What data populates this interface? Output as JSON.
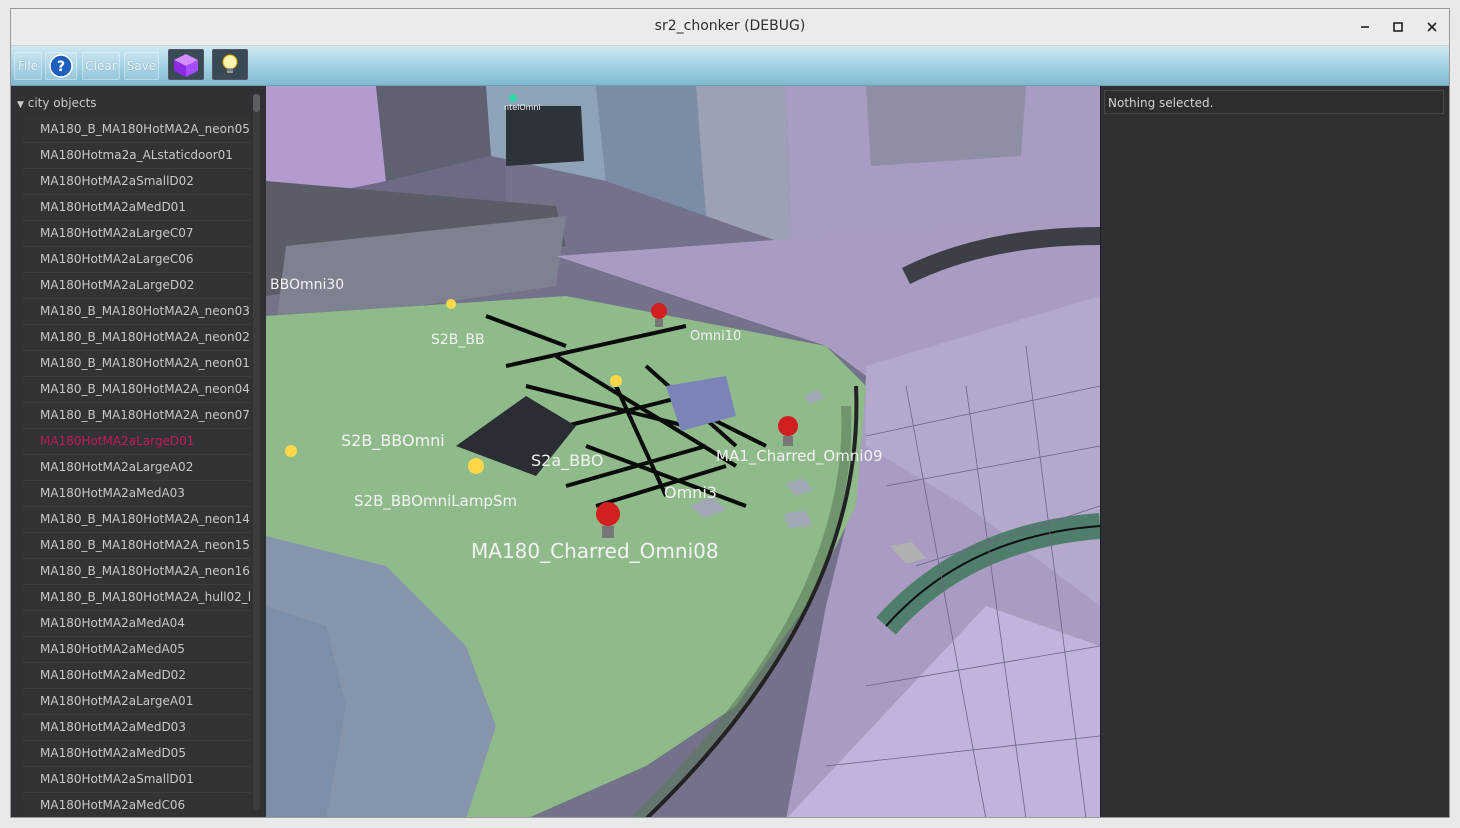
{
  "window": {
    "title": "sr2_chonker (DEBUG)",
    "minimize_icon": "minimize-icon",
    "maximize_icon": "maximize-icon",
    "close_icon": "close-icon"
  },
  "toolbar": {
    "file_label": "File",
    "help_icon": "help-icon",
    "clear_label": "Clear",
    "save_label": "Save",
    "cube_icon": "cube-icon",
    "lightbulb_icon": "lightbulb-icon"
  },
  "tree": {
    "root_label": "city objects",
    "selected_index": 12,
    "selected_color": "#c2185b",
    "items": [
      "MA180_B_MA180HotMA2A_neon05",
      "MA180Hotma2a_ALstaticdoor01",
      "MA180HotMA2aSmallD02",
      "MA180HotMA2aMedD01",
      "MA180HotMA2aLargeC07",
      "MA180HotMA2aLargeC06",
      "MA180HotMA2aLargeD02",
      "MA180_B_MA180HotMA2A_neon03",
      "MA180_B_MA180HotMA2A_neon02",
      "MA180_B_MA180HotMA2A_neon01",
      "MA180_B_MA180HotMA2A_neon04",
      "MA180_B_MA180HotMA2A_neon07",
      "MA180HotMA2aLargeD01",
      "MA180HotMA2aLargeA02",
      "MA180HotMA2aMedA03",
      "MA180_B_MA180HotMA2A_neon14",
      "MA180_B_MA180HotMA2A_neon15",
      "MA180_B_MA180HotMA2A_neon16",
      "MA180_B_MA180HotMA2A_hull02_l",
      "MA180HotMA2aMedA04",
      "MA180HotMA2aMedA05",
      "MA180HotMA2aMedD02",
      "MA180HotMA2aLargeA01",
      "MA180HotMA2aMedD03",
      "MA180HotMA2aMedD05",
      "MA180HotMA2aSmallD01",
      "MA180HotMA2aMedC06"
    ]
  },
  "viewport": {
    "labels": [
      "BBOmni30",
      "S2B_BB",
      "Omni10",
      "S2B_BBOmni",
      "S2a_BBO",
      "MA1_Charred_Omni09",
      "S2B_BBOmniLampSm",
      "Omni3",
      "MA180_Charred_Omni08",
      "ntelOmni"
    ]
  },
  "details": {
    "status_text": "Nothing selected."
  }
}
